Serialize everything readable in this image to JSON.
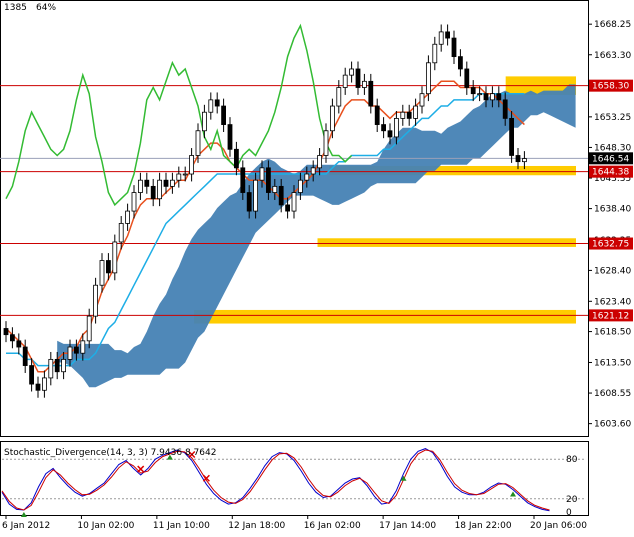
{
  "header": {
    "code": "1385",
    "zoom": "64%"
  },
  "chart_data": [
    {
      "type": "candlestick",
      "ylim": [
        1601.6,
        1672.0
      ],
      "y_ticks": [
        "1668.25",
        "1663.30",
        "1658.30",
        "1653.25",
        "1648.30",
        "1643.35",
        "1638.40",
        "1633.35",
        "1628.40",
        "1623.40",
        "1618.50",
        "1613.50",
        "1608.55",
        "1603.60"
      ],
      "x_ticks": [
        "6 Jan 2012",
        "10 Jan 02:00",
        "11 Jan 10:00",
        "12 Jan 18:00",
        "16 Jan 02:00",
        "17 Jan 14:00",
        "18 Jan 22:00",
        "20 Jan 06:00"
      ],
      "levels": [
        {
          "label": "1658.30",
          "value": 1658.3
        },
        {
          "label": "1644.38",
          "value": 1644.38
        },
        {
          "label": "1632.75",
          "value": 1632.75
        },
        {
          "label": "1621.12",
          "value": 1621.12
        }
      ],
      "current_price": {
        "label": "1646.54",
        "value": 1646.54
      },
      "zones": [
        {
          "low": 1656.8,
          "high": 1659.8
        },
        {
          "low": 1643.8,
          "high": 1645.3
        },
        {
          "low": 1632.2,
          "high": 1633.6
        },
        {
          "low": 1619.8,
          "high": 1622.0
        }
      ],
      "close": [
        1618,
        1617,
        1616,
        1613,
        1610,
        1609,
        1611,
        1614,
        1612,
        1614,
        1616,
        1615,
        1617,
        1621,
        1626,
        1630,
        1628,
        1633,
        1636,
        1638,
        1641,
        1643,
        1642,
        1640,
        1643,
        1642,
        1643,
        1644,
        1644,
        1647,
        1651,
        1654,
        1656,
        1655,
        1652,
        1648,
        1645,
        1641,
        1638,
        1643,
        1645,
        1641,
        1642,
        1639,
        1638,
        1641,
        1643,
        1644,
        1645,
        1647,
        1651,
        1655,
        1658,
        1660,
        1661,
        1658,
        1659,
        1655,
        1652,
        1651,
        1650,
        1653,
        1654,
        1653,
        1655,
        1657,
        1662,
        1665,
        1667,
        1666,
        1663,
        1661,
        1658,
        1657,
        1657,
        1656,
        1657,
        1656,
        1653,
        1647,
        1646,
        1646.5
      ],
      "tenkan": [
        1619,
        1618,
        1617,
        1616,
        1614,
        1612,
        1612,
        1613,
        1614,
        1615,
        1615,
        1616,
        1618,
        1619,
        1622,
        1625,
        1627,
        1629,
        1632,
        1634,
        1637,
        1639,
        1640,
        1640,
        1640,
        1641,
        1642,
        1643,
        1643,
        1645,
        1647,
        1648,
        1649,
        1649,
        1648,
        1646,
        1645,
        1644,
        1643,
        1643,
        1643,
        1642,
        1641,
        1640,
        1640,
        1641,
        1642,
        1643,
        1644,
        1646,
        1648,
        1651,
        1653,
        1655,
        1656,
        1656,
        1656,
        1655,
        1655,
        1654,
        1653,
        1654,
        1654,
        1654,
        1655,
        1656,
        1657,
        1658,
        1659,
        1659,
        1659,
        1658,
        1658,
        1658,
        1658,
        1657,
        1657,
        1656,
        1655,
        1654,
        1653,
        1652
      ],
      "kijun": [
        1615,
        1615,
        1615,
        1614,
        1614,
        1613,
        1613,
        1613,
        1613,
        1613,
        1613,
        1614,
        1614,
        1614,
        1615,
        1617,
        1619,
        1620,
        1622,
        1624,
        1626,
        1628,
        1630,
        1632,
        1634,
        1636,
        1637,
        1638,
        1639,
        1640,
        1641,
        1642,
        1643,
        1644,
        1644,
        1644,
        1644,
        1644,
        1644,
        1644,
        1644,
        1644,
        1644,
        1644,
        1644,
        1644,
        1644,
        1644,
        1644,
        1644,
        1644,
        1645,
        1646,
        1646,
        1647,
        1647,
        1647,
        1647,
        1647,
        1648,
        1648,
        1649,
        1650,
        1651,
        1652,
        1653,
        1653,
        1654,
        1655,
        1655,
        1656,
        1656,
        1656,
        1656,
        1657,
        1657,
        1657,
        1657,
        1657,
        1657,
        1657,
        1657
      ],
      "chikou": [
        1640,
        1642,
        1646,
        1651,
        1654,
        1652,
        1650,
        1648,
        1647,
        1648,
        1651,
        1656,
        1660,
        1657,
        1650,
        1646,
        1641,
        1639,
        1640,
        1641,
        1644,
        1649,
        1656,
        1658,
        1656,
        1659,
        1662,
        1660,
        1661,
        1658,
        1655,
        1650,
        1648,
        1651,
        1647,
        1646,
        1645,
        1647,
        1648,
        1647,
        1649,
        1651,
        1654,
        1658,
        1663,
        1666,
        1668,
        1664,
        1659,
        1653,
        1649,
        1647,
        1647,
        1646,
        1647
      ]
    },
    {
      "type": "line",
      "label": "Stochastic_Divergence(14, 3, 3) 7.9436 8.7642",
      "ylim": [
        0,
        100
      ],
      "y_ticks": [
        "80",
        "20",
        "0"
      ],
      "main": [
        30,
        12,
        4,
        3,
        14,
        38,
        58,
        66,
        52,
        40,
        30,
        24,
        28,
        36,
        44,
        58,
        72,
        78,
        66,
        56,
        66,
        80,
        86,
        90,
        94,
        90,
        78,
        60,
        42,
        28,
        18,
        12,
        14,
        22,
        36,
        52,
        70,
        84,
        90,
        88,
        78,
        62,
        44,
        30,
        22,
        24,
        34,
        44,
        50,
        52,
        40,
        24,
        12,
        14,
        32,
        58,
        80,
        92,
        96,
        90,
        74,
        54,
        38,
        30,
        26,
        26,
        30,
        38,
        44,
        42,
        34,
        24,
        14,
        8,
        4,
        2
      ],
      "signal": [
        32,
        16,
        6,
        3,
        10,
        30,
        52,
        64,
        56,
        44,
        34,
        26,
        27,
        33,
        41,
        53,
        67,
        76,
        70,
        59,
        62,
        75,
        84,
        88,
        92,
        91,
        82,
        66,
        48,
        33,
        22,
        15,
        13,
        19,
        31,
        47,
        64,
        79,
        88,
        89,
        82,
        68,
        50,
        35,
        25,
        23,
        30,
        40,
        47,
        51,
        44,
        30,
        17,
        13,
        25,
        49,
        73,
        88,
        94,
        92,
        79,
        60,
        43,
        33,
        28,
        26,
        28,
        35,
        42,
        43,
        37,
        27,
        17,
        10,
        6,
        3
      ],
      "buy_markers": [
        3,
        23,
        55,
        70
      ],
      "sell_markers": [
        19,
        26,
        28
      ]
    }
  ]
}
